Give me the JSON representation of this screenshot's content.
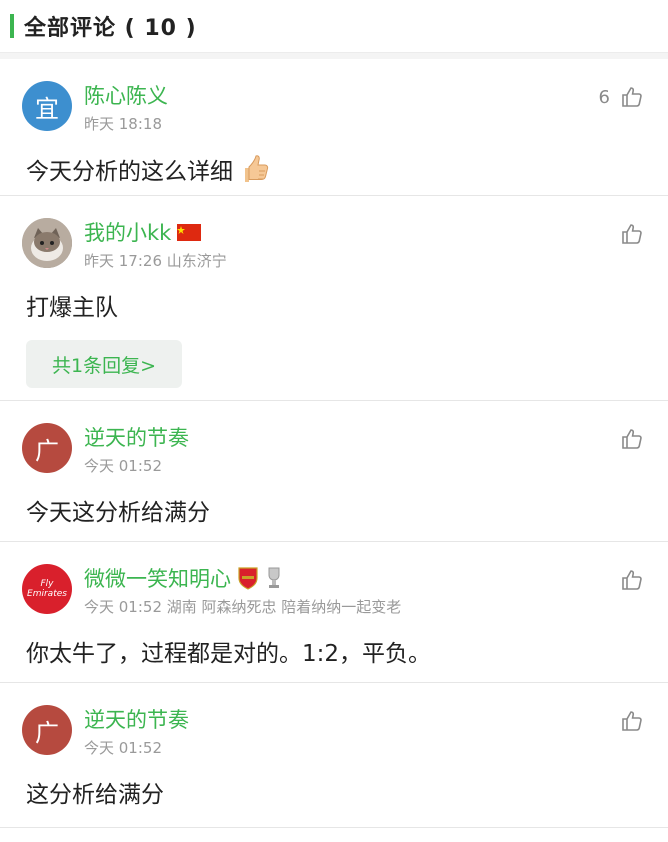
{
  "header": {
    "title": "全部评论 ( 10 )"
  },
  "comments": [
    {
      "avatar_text": "宜",
      "avatar_color": "#3d8fcf",
      "name": "陈心陈义",
      "meta": "昨天 18:18",
      "like_count": "6",
      "text": "今天分析的这么详细",
      "emoji": "thumbs-up-emoji"
    },
    {
      "avatar_text": "",
      "avatar_color": "#9a8f85",
      "name": "我的小kk",
      "badge": "china-flag",
      "meta": "昨天 17:26 山东济宁",
      "text": "打爆主队",
      "reply_label": "共1条回复>"
    },
    {
      "avatar_text": "广",
      "avatar_color": "#b64a3f",
      "name": "逆天的节奏",
      "meta": "今天 01:52",
      "text": "今天这分析给满分"
    },
    {
      "avatar_text": "Fly Emirates",
      "avatar_color": "#d9202c",
      "name": "微微一笑知明心",
      "badge": "arsenal-badge",
      "meta": "今天 01:52 湖南 阿森纳死忠 陪着纳纳一起变老",
      "text": "你太牛了，过程都是对的。1:2，平负。"
    },
    {
      "avatar_text": "广",
      "avatar_color": "#b64a3f",
      "name": "逆天的节奏",
      "meta": "今天 01:52",
      "text": "这分析给满分"
    }
  ]
}
